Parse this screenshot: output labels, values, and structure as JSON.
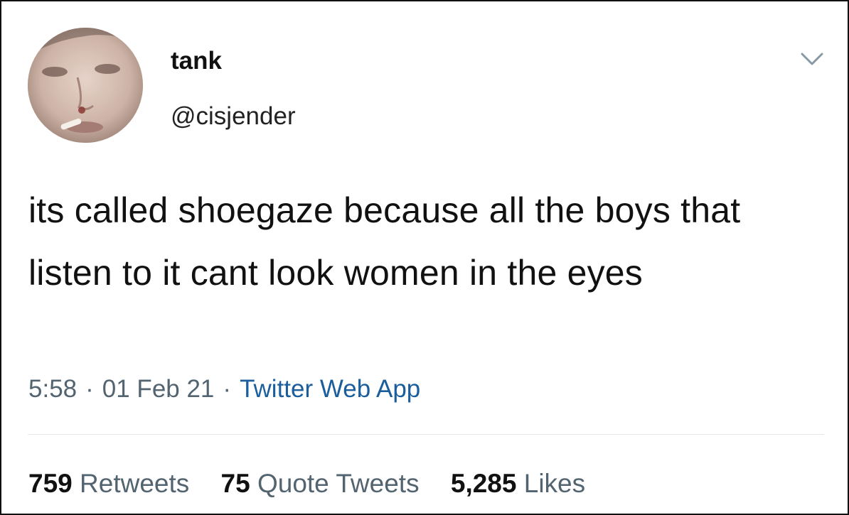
{
  "tweet": {
    "author": {
      "display_name": "tank",
      "handle": "@cisjender",
      "avatar": "profile-photo"
    },
    "menu_icon": "chevron-down-icon",
    "text": "its called shoegaze because all the boys that listen to it cant look women in the eyes",
    "time": "5:58",
    "date": "01 Feb 21",
    "separator": "·",
    "source": "Twitter Web App",
    "stats": {
      "retweets": {
        "count": "759",
        "label": "Retweets"
      },
      "quote_tweets": {
        "count": "75",
        "label": "Quote Tweets"
      },
      "likes": {
        "count": "5,285",
        "label": "Likes"
      }
    }
  },
  "colors": {
    "text": "#111111",
    "secondary": "#536471",
    "link": "#1b5e9c",
    "divider": "#e4e7ea"
  }
}
